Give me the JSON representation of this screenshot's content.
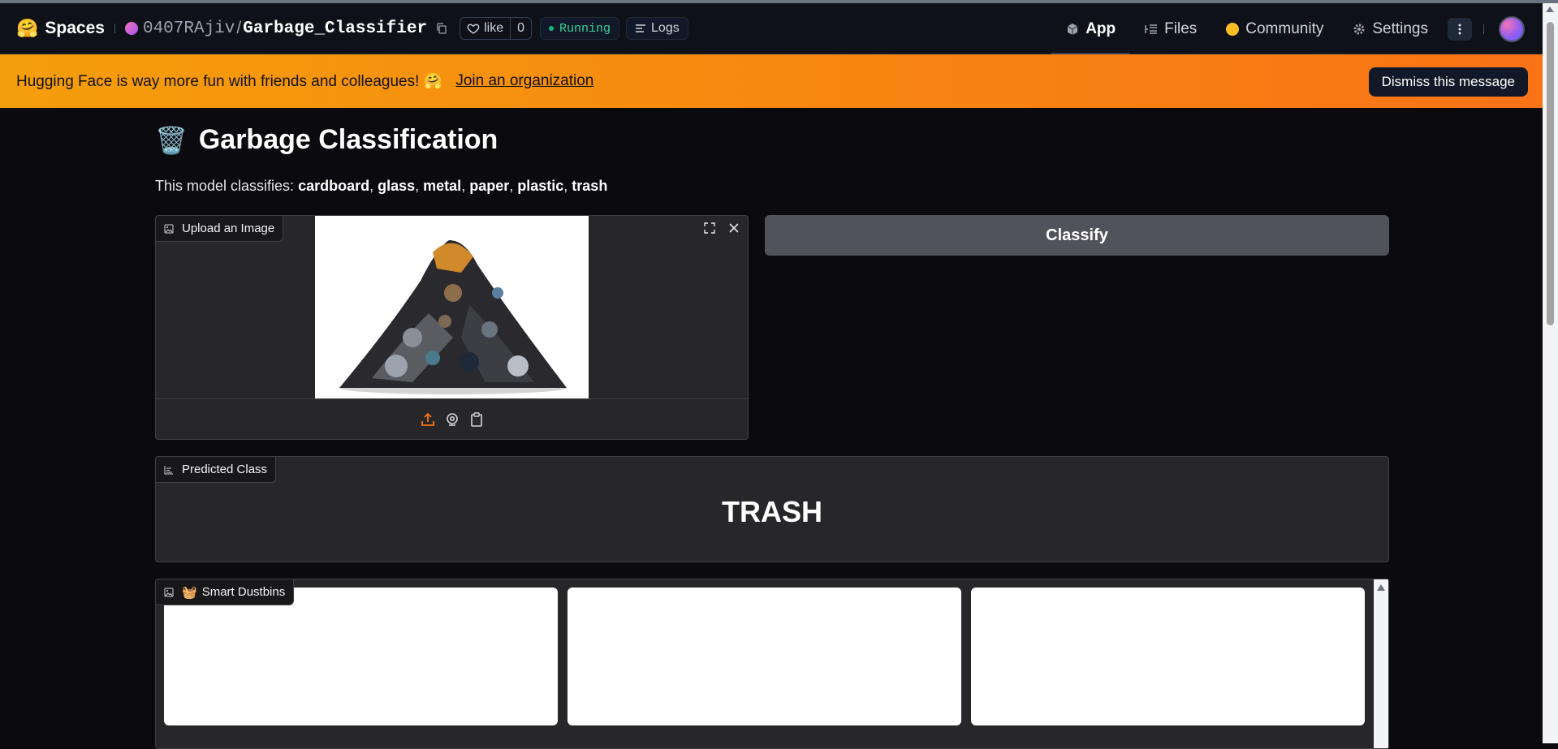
{
  "topbar": {
    "brand_emoji": "🤗",
    "brand": "Spaces",
    "owner": "0407RAjiv",
    "separator": "/",
    "repo": "Garbage_Classifier",
    "like_label": "like",
    "like_count": "0",
    "status": "Running",
    "logs_label": "Logs",
    "nav": [
      {
        "label": "App",
        "icon": "cube-icon"
      },
      {
        "label": "Files",
        "icon": "files-icon"
      },
      {
        "label": "Community",
        "icon": "hug-hands-icon"
      },
      {
        "label": "Settings",
        "icon": "gear-icon"
      }
    ]
  },
  "banner": {
    "message": "Hugging Face is way more fun with friends and colleagues! 🤗",
    "join_link": "Join an organization",
    "dismiss": "Dismiss this message"
  },
  "app": {
    "title_emoji": "🗑️",
    "title": "Garbage Classification",
    "desc_prefix": "This model classifies: ",
    "classes": [
      "cardboard",
      "glass",
      "metal",
      "paper",
      "plastic",
      "trash"
    ],
    "upload_label": "Upload an Image",
    "classify_button": "Classify",
    "predicted_label": "Predicted Class",
    "predicted_value": "TRASH",
    "gallery_emoji": "🧺",
    "gallery_label": "Smart Dustbins"
  },
  "colors": {
    "accent_orange": "#f97316",
    "status_green": "#34d399",
    "banner_start": "#f59e0b",
    "banner_end": "#f97316"
  }
}
